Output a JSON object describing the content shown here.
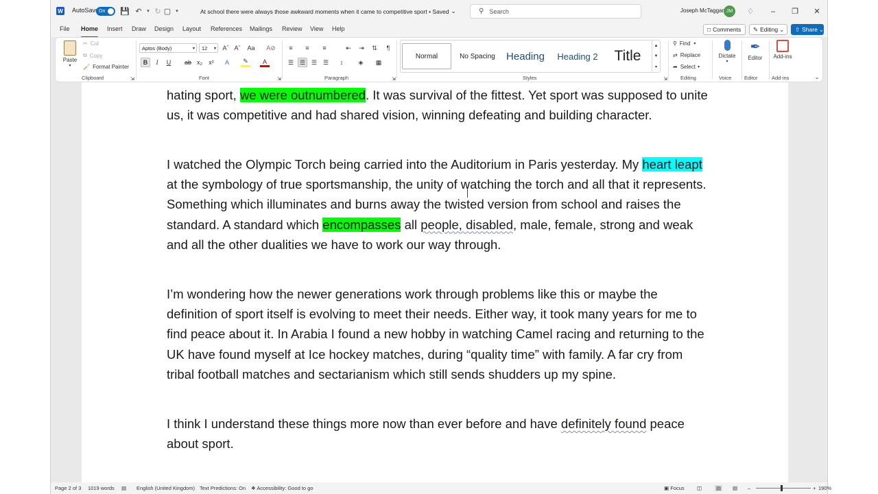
{
  "titlebar": {
    "app_icon": "word-logo-icon",
    "autosave_label": "AutoSave",
    "autosave_state": "On",
    "doc_title": "At school there were always those awkward moments when it came to competitive sport",
    "saved_status": "Saved",
    "search_placeholder": "Search",
    "user_name": "Joseph McTaggart",
    "user_initials": "JM"
  },
  "menu": {
    "tabs": [
      "File",
      "Home",
      "Insert",
      "Draw",
      "Design",
      "Layout",
      "References",
      "Mailings",
      "Review",
      "View",
      "Help"
    ],
    "active_tab": "Home",
    "comments_label": "Comments",
    "editing_label": "Editing",
    "share_label": "Share"
  },
  "ribbon": {
    "clipboard": {
      "paste": "Paste",
      "cut": "Cut",
      "copy": "Copy",
      "format_painter": "Format Painter",
      "label": "Clipboard"
    },
    "font": {
      "font_name": "Aptos (Body)",
      "font_size": "12",
      "label": "Font"
    },
    "paragraph": {
      "label": "Paragraph"
    },
    "styles": {
      "items": [
        "Normal",
        "No Spacing",
        "Heading",
        "Heading 2",
        "Title"
      ],
      "label": "Styles"
    },
    "editing": {
      "find": "Find",
      "replace": "Replace",
      "select": "Select",
      "label": "Editing"
    },
    "voice": {
      "dictate": "Dictate",
      "label": "Voice"
    },
    "editor": {
      "editor": "Editor",
      "label": "Editor"
    },
    "addins": {
      "addins": "Add-ins",
      "label": "Add-ins"
    }
  },
  "document": {
    "p1": {
      "a": "hating sport, ",
      "hl1": "we were outnumbered",
      "b": ". It was survival of the fittest. Yet sport was supposed to unite us, it was competitive and had shared vision, winning defeating and building character."
    },
    "p2": {
      "a": " I watched the Olympic Torch being carried into the Auditorium in Paris yesterday. My ",
      "hl1": "heart leapt",
      "b": " at the symbology of true sportsmanship, the unity of watching the torch and all that it represents. Something which illuminates and burns away the twisted version from school and raises the standard. A standard which ",
      "hl2": "encompasses",
      "c": " all ",
      "sq1": "people, disabled",
      "d": ", male, female, strong and weak and all the other dualities we have to work our way through."
    },
    "p3": "I’m wondering how the newer generations work through problems like this or maybe the definition of sport itself is evolving to meet their needs. Either way, it took many years for me to find peace about it. In Arabia I found a new hobby in watching Camel racing and returning to the UK have found myself at Ice hockey matches, during “quality time” with family.  A far cry from tribal football matches and sectarianism which still sends shudders up my spine.",
    "p4": {
      "a": " I think I understand these things more now than ever before and have ",
      "sq1": "definitely found",
      "b": " peace about sport."
    }
  },
  "statusbar": {
    "page": "Page 2 of 3",
    "words": "1019 words",
    "language": "English (United Kingdom)",
    "text_predictions": "Text Predictions: On",
    "accessibility": "Accessibility: Good to go",
    "focus": "Focus",
    "zoom": "190%"
  },
  "colors": {
    "accent": "#185abd",
    "highlight_green": "#00ff00",
    "highlight_cyan": "#00ffff"
  }
}
